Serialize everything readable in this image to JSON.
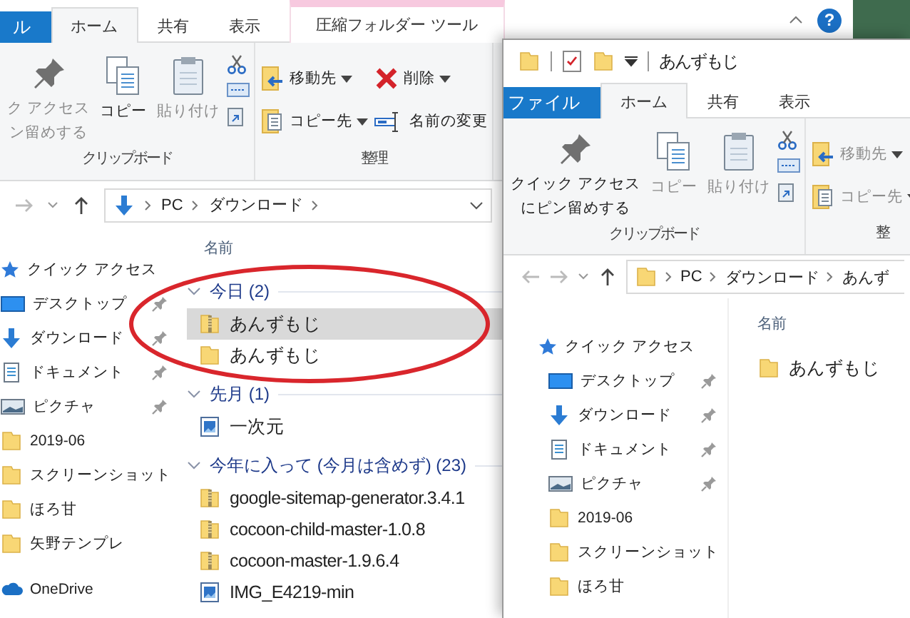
{
  "back_window": {
    "tabs": [
      {
        "label": "ル",
        "kind": "file",
        "selected": false
      },
      {
        "label": "ホーム",
        "kind": "normal",
        "selected": true
      },
      {
        "label": "共有",
        "kind": "normal",
        "selected": false
      },
      {
        "label": "表示",
        "kind": "normal",
        "selected": false
      },
      {
        "label": "圧縮フォルダー ツール",
        "kind": "context",
        "selected": false
      }
    ],
    "help_button": "?",
    "ribbon_groups": [
      {
        "label": "クリップボード",
        "kind": "clipboard",
        "buttons": [
          {
            "lines": [
              "ク アクセス",
              "ン留めする"
            ],
            "kind": "pin",
            "disabled": true
          },
          {
            "label": "コピー",
            "kind": "copy",
            "disabled": false
          },
          {
            "label": "貼り付け",
            "kind": "paste",
            "disabled": true
          }
        ]
      },
      {
        "label": "整理",
        "kind": "organize",
        "buttons": [
          {
            "label": "移動先",
            "kind": "move-to",
            "dropdown": true,
            "disabled": false
          },
          {
            "label": "コピー先",
            "kind": "copy-to",
            "dropdown": true,
            "disabled": false
          },
          {
            "label": "削除",
            "kind": "delete",
            "dropdown": true,
            "disabled": false
          },
          {
            "label": "名前の変更",
            "kind": "rename",
            "dropdown": false,
            "disabled": false
          }
        ]
      }
    ],
    "address": {
      "kind": "downloads",
      "path": [
        "PC",
        "ダウンロード"
      ],
      "ends_with_separator": true
    },
    "nav": [
      {
        "label": "クイック アクセス",
        "kind": "quick-access",
        "pinned": false
      },
      {
        "label": "デスクトップ",
        "kind": "desktop",
        "pinned": true
      },
      {
        "label": "ダウンロード",
        "kind": "downloads",
        "pinned": true
      },
      {
        "label": "ドキュメント",
        "kind": "documents",
        "pinned": true
      },
      {
        "label": "ピクチャ",
        "kind": "pictures",
        "pinned": true
      },
      {
        "label": "2019-06",
        "kind": "folder",
        "pinned": false
      },
      {
        "label": "スクリーンショット",
        "kind": "folder",
        "pinned": false
      },
      {
        "label": "ほろ甘",
        "kind": "folder",
        "pinned": false
      },
      {
        "label": "矢野テンプレ",
        "kind": "folder",
        "pinned": false
      },
      {
        "label": "OneDrive",
        "kind": "onedrive",
        "pinned": false
      }
    ],
    "column_header": "名前",
    "groups": [
      {
        "label": "今日 (2)",
        "expanded": true,
        "items": [
          {
            "name": "あんずもじ",
            "kind": "zip",
            "selected": true
          },
          {
            "name": "あんずもじ",
            "kind": "folder",
            "selected": false
          }
        ]
      },
      {
        "label": "先月 (1)",
        "expanded": true,
        "items": [
          {
            "name": "一次元",
            "kind": "image",
            "selected": false
          }
        ]
      },
      {
        "label": "今年に入って (今月は含めず) (23)",
        "expanded": true,
        "items": [
          {
            "name": "google-sitemap-generator.3.4.1",
            "kind": "zip",
            "selected": false
          },
          {
            "name": "cocoon-child-master-1.0.8",
            "kind": "zip",
            "selected": false
          },
          {
            "name": "cocoon-master-1.9.6.4",
            "kind": "zip",
            "selected": false
          },
          {
            "name": "IMG_E4219-min",
            "kind": "image",
            "selected": false
          }
        ]
      }
    ]
  },
  "front_window": {
    "title": "あんずもじ",
    "tabs": [
      {
        "label": "ファイル",
        "kind": "file",
        "selected": false
      },
      {
        "label": "ホーム",
        "kind": "normal",
        "selected": true
      },
      {
        "label": "共有",
        "kind": "normal",
        "selected": false
      },
      {
        "label": "表示",
        "kind": "normal",
        "selected": false
      }
    ],
    "ribbon_groups": [
      {
        "label": "クリップボード",
        "kind": "clipboard",
        "buttons": [
          {
            "lines": [
              "クイック アクセス",
              "にピン留めする"
            ],
            "kind": "pin",
            "disabled": false
          },
          {
            "label": "コピー",
            "kind": "copy",
            "disabled": true
          },
          {
            "label": "貼り付け",
            "kind": "paste",
            "disabled": true
          }
        ]
      },
      {
        "label": "整",
        "kind": "organize",
        "buttons": [
          {
            "label": "移動先",
            "kind": "move-to",
            "dropdown": true,
            "disabled": true
          },
          {
            "label": "コピー先",
            "kind": "copy-to",
            "dropdown": true,
            "disabled": true
          }
        ]
      }
    ],
    "address": {
      "kind": "folder",
      "path": [
        "PC",
        "ダウンロード",
        "あんず"
      ],
      "ends_with_separator": false
    },
    "nav": [
      {
        "label": "クイック アクセス",
        "kind": "quick-access",
        "pinned": false
      },
      {
        "label": "デスクトップ",
        "kind": "desktop",
        "pinned": true
      },
      {
        "label": "ダウンロード",
        "kind": "downloads",
        "pinned": true
      },
      {
        "label": "ドキュメント",
        "kind": "documents",
        "pinned": true
      },
      {
        "label": "ピクチャ",
        "kind": "pictures",
        "pinned": true
      },
      {
        "label": "2019-06",
        "kind": "folder",
        "pinned": false
      },
      {
        "label": "スクリーンショット",
        "kind": "folder",
        "pinned": false
      },
      {
        "label": "ほろ甘",
        "kind": "folder",
        "pinned": false
      }
    ],
    "column_header": "名前",
    "files": [
      {
        "name": "あんずもじ",
        "kind": "folder",
        "selected": false
      }
    ]
  }
}
